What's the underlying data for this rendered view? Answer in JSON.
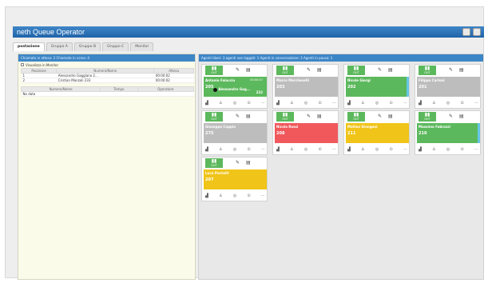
{
  "app": {
    "title": "neth Queue Operator"
  },
  "tabs": [
    {
      "label": "postazione"
    },
    {
      "label": "Gruppo A"
    },
    {
      "label": "Gruppo B"
    },
    {
      "label": "Gruppo C"
    },
    {
      "label": "Monitor"
    }
  ],
  "left_panel": {
    "header": "Chiamate in attesa: 2  Chiamate in corso: 4",
    "subheader": "Visualizza in Monitor",
    "table1": {
      "columns": [
        "Posizione",
        "Numero/Nome",
        "Attesa"
      ],
      "rows": [
        [
          "1",
          "Alessandro Gaggiano 2...",
          "00:00:02"
        ],
        [
          "2",
          "Cristian Manzoli 233",
          "00:00:02"
        ]
      ]
    },
    "table2": {
      "columns": [
        "Numero/Nome",
        "Tempo",
        "Operatore"
      ],
      "rows": [
        [
          "No data",
          "",
          ""
        ]
      ]
    }
  },
  "right_panel": {
    "header": "Agenti liberi: 3 agenti non loggati: 1 Agenti in conversazione: 3 Agenti in pausa: 1"
  },
  "agents": [
    {
      "name": "Antonio Faiaccia",
      "right": "00:00:07",
      "ext": "205",
      "caller": "Alessandro Gag...",
      "sub": "232",
      "color": "green",
      "bar": "#5cb85c"
    },
    {
      "name": "Marco Marcheselli",
      "right": "",
      "ext": "203",
      "caller": "",
      "sub": "",
      "color": "grey",
      "bar": ""
    },
    {
      "name": "Nicole Giorgi",
      "right": "",
      "ext": "202",
      "caller": "",
      "sub": "",
      "color": "green",
      "bar": "#66c6e6"
    },
    {
      "name": "Filippo Carloni",
      "right": "",
      "ext": "201",
      "caller": "",
      "sub": "",
      "color": "grey",
      "bar": ""
    },
    {
      "name": "Giuseppe Coppia",
      "right": "",
      "ext": "275",
      "caller": "",
      "sub": "",
      "color": "grey",
      "bar": ""
    },
    {
      "name": "Nicola Rossi",
      "right": "",
      "ext": "208",
      "caller": "",
      "sub": "",
      "color": "red",
      "bar": ""
    },
    {
      "name": "Matteo Stangoni",
      "right": "",
      "ext": "211",
      "caller": "",
      "sub": "",
      "color": "yellow",
      "bar": ""
    },
    {
      "name": "Massimo Fabrazzi",
      "right": "",
      "ext": "210",
      "caller": "",
      "sub": "",
      "color": "green",
      "bar": "#66c6e6"
    },
    {
      "name": "Luca Pontalti",
      "right": "",
      "ext": "207",
      "caller": "",
      "sub": "",
      "color": "yellow",
      "bar": ""
    }
  ],
  "icons": {
    "title_left": "scissors-icon",
    "title_right": "gear-icon",
    "card_pause": "pause-icon",
    "card_chat": "chat-icon",
    "card_doc": "document-icon",
    "foot": [
      "transfer-icon",
      "user-icon",
      "settings-icon",
      "headset-icon",
      "more-icon"
    ]
  }
}
